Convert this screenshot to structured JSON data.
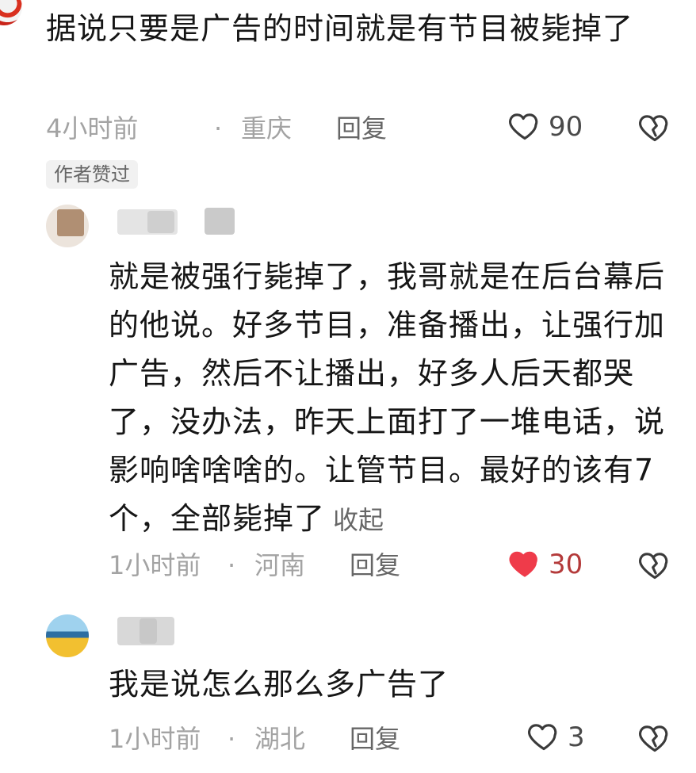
{
  "comments": [
    {
      "text": "据说只要是广告的时间就是有节目被毙掉了",
      "meta": {
        "time": "4小时前",
        "dot": "·",
        "location": "重庆",
        "reply": "回复"
      },
      "likes": "90",
      "liked": false,
      "tag": "作者赞过"
    },
    {
      "text": "就是被强行毙掉了，我哥就是在后台幕后的他说。好多节目，准备播出，让强行加广告，然后不让播出，好多人后天都哭了，没办法，昨天上面打了一堆电话，说影响啥啥啥的。让管节目。最好的该有7个，全部毙掉了",
      "collapse": "收起",
      "meta": {
        "time": "1小时前",
        "dot": "·",
        "location": "河南",
        "reply": "回复"
      },
      "likes": "30",
      "liked": true
    },
    {
      "text": "我是说怎么那么多广告了",
      "meta": {
        "time": "1小时前",
        "dot": "·",
        "location": "湖北",
        "reply": "回复"
      },
      "likes": "3",
      "liked": false
    }
  ],
  "icons": {
    "like": "heart-icon",
    "dislike": "broken-heart-icon"
  },
  "colors": {
    "liked": "#ef3b4a",
    "text": "#161616",
    "meta": "#a3a3a3"
  }
}
